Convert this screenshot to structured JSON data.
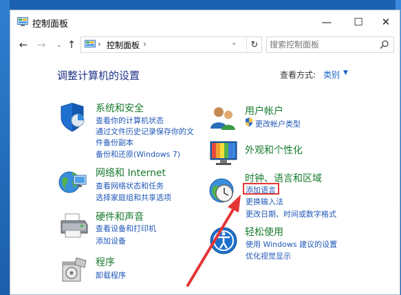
{
  "window": {
    "title": "控制面板",
    "controls": {
      "minimize": "—",
      "maximize": "☐",
      "close": "✕"
    }
  },
  "nav": {
    "back": "←",
    "forward": "→",
    "recent": "⌄",
    "up": "↑",
    "address": {
      "separator": "›",
      "path": "控制面板",
      "dropdown": "⌄",
      "refresh": "↻"
    },
    "search_placeholder": "搜索控制面板"
  },
  "main": {
    "heading": "调整计算机的设置",
    "view_by_label": "查看方式:",
    "view_by_value": "类别",
    "view_by_caret": "▼"
  },
  "categories": {
    "security": {
      "title": "系统和安全",
      "links": [
        "查看你的计算机状态",
        "通过文件历史记录保存你的文",
        "件备份副本",
        "备份和还原(Windows 7)"
      ]
    },
    "network": {
      "title": "网络和 Internet",
      "links": [
        "查看网络状态和任务",
        "选择家庭组和共享选项"
      ]
    },
    "hardware": {
      "title": "硬件和声音",
      "links": [
        "查看设备和打印机",
        "添加设备"
      ]
    },
    "programs": {
      "title": "程序",
      "links": [
        "卸载程序"
      ]
    },
    "users": {
      "title": "用户帐户",
      "links": [
        "更改帐户类型"
      ]
    },
    "appearance": {
      "title": "外观和个性化",
      "links": []
    },
    "clock": {
      "title": "时钟、语言和区域",
      "links": [
        "添加语言",
        "更换输入法",
        "更改日期、时间或数字格式"
      ]
    },
    "ease": {
      "title": "轻松使用",
      "links": [
        "使用 Windows 建议的设置",
        "优化视觉显示"
      ]
    }
  },
  "colors": {
    "category_title": "#177a2d",
    "link": "#1f57b8",
    "heading": "#1e3287",
    "annotation": "#e53434"
  }
}
